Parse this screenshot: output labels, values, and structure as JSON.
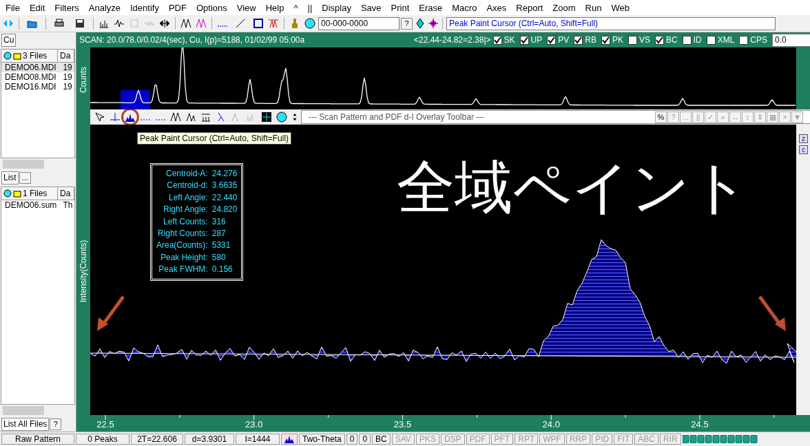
{
  "menu": [
    "File",
    "Edit",
    "Filters",
    "Analyze",
    "Identify",
    "PDF",
    "Options",
    "View",
    "Help",
    "^",
    "||",
    "Display",
    "Save",
    "Print",
    "Erase",
    "Macro",
    "Axes",
    "Report",
    "Zoom",
    "Run",
    "Web"
  ],
  "toolbar": {
    "card_field": "00-000-0000",
    "message": "Peak Paint Cursor (Ctrl=Auto, Shift=Full)",
    "help_button": "?"
  },
  "left_panel": {
    "top_combo": "Cu",
    "scan_list": {
      "header": "3 Files",
      "column_2": "Da",
      "rows": [
        {
          "name": "DEMO06.MDI",
          "column_2": "19",
          "selected": true
        },
        {
          "name": "DEMO08.MDI",
          "column_2": "19",
          "selected": false
        },
        {
          "name": "DEMO16.MDI",
          "column_2": "19",
          "selected": false
        }
      ]
    },
    "list_combo": "List",
    "list_button": "...",
    "sum_list": {
      "header": "1 Files",
      "column_2": "Da",
      "rows": [
        {
          "name": "DEMO06.sum",
          "column_2": "Th",
          "selected": false
        }
      ]
    },
    "bottom_combo": "List All Files",
    "bottom_button": "?"
  },
  "scan_header": {
    "info": "SCAN: 20.0/78.0/0.02/4(sec), Cu, I(p)=5188, 01/02/99 05:00a",
    "range": "<22.44-24.82=2.38|>",
    "flags": [
      {
        "label": "SK",
        "checked": true
      },
      {
        "label": "UP",
        "checked": true
      },
      {
        "label": "PV",
        "checked": true
      },
      {
        "label": "RB",
        "checked": true
      },
      {
        "label": "PK",
        "checked": true
      },
      {
        "label": "VS",
        "checked": false
      },
      {
        "label": "BC",
        "checked": true
      },
      {
        "label": "ID",
        "checked": false
      },
      {
        "label": "XML",
        "checked": false
      },
      {
        "label": "CPS",
        "checked": false
      }
    ],
    "spin_value": "0.0"
  },
  "top_plot": {
    "ylabel": "Counts"
  },
  "overlay_toolbar": {
    "title": "--- Scan Pattern and PDF d-I Overlay Toolbar ---",
    "buttons": [
      "%",
      "?",
      "...",
      "||",
      "✓",
      "»",
      "↔",
      "↕",
      "⇕",
      "▦",
      "×",
      "▼"
    ]
  },
  "tooltip": "Peak Paint Cursor (Ctrl=Auto, Shift=Full)",
  "main_plot": {
    "ylabel": "Intensity(Counts)",
    "overlay_text": "全域ペイント",
    "peak_info": [
      {
        "label": "Centroid-A:",
        "value": "24.276"
      },
      {
        "label": "Centroid-d:",
        "value": "3.6635"
      },
      {
        "label": "Left Angle:",
        "value": "22.440"
      },
      {
        "label": "Right Angle:",
        "value": "24.820"
      },
      {
        "label": "Left Counts:",
        "value": "316"
      },
      {
        "label": "Right Counts:",
        "value": "287"
      },
      {
        "label": "Area(Counts):",
        "value": "5331"
      },
      {
        "label": "Peak Height:",
        "value": "580"
      },
      {
        "label": "Peak FWHM:",
        "value": "0.156"
      }
    ],
    "xticks": [
      "22.5",
      "23.0",
      "23.5",
      "24.0",
      "24.5"
    ],
    "side_buttons": [
      "z",
      "c"
    ]
  },
  "status_bar": [
    {
      "text": "Raw Pattern",
      "disabled": false
    },
    {
      "text": "0 Peaks",
      "disabled": false
    },
    {
      "text": "2T=22.606",
      "disabled": false
    },
    {
      "text": "d=3.9301",
      "disabled": false
    },
    {
      "text": "I=1444",
      "disabled": false
    },
    {
      "kind": "icon"
    },
    {
      "text": "Two-Theta",
      "disabled": false
    },
    {
      "text": "0",
      "disabled": false
    },
    {
      "text": "0",
      "disabled": false
    },
    {
      "text": "BC",
      "disabled": false
    },
    {
      "text": "SAV",
      "disabled": true
    },
    {
      "text": "PKS",
      "disabled": true
    },
    {
      "text": "DSP",
      "disabled": true
    },
    {
      "text": "PDF",
      "disabled": true
    },
    {
      "text": "PFT",
      "disabled": true
    },
    {
      "text": "RPT",
      "disabled": true
    },
    {
      "text": "WPF",
      "disabled": true
    },
    {
      "text": "RRP",
      "disabled": true
    },
    {
      "text": "PID",
      "disabled": true
    },
    {
      "text": "FIT",
      "disabled": true
    },
    {
      "text": "ABC",
      "disabled": true
    },
    {
      "text": "RIR",
      "disabled": true
    }
  ]
}
